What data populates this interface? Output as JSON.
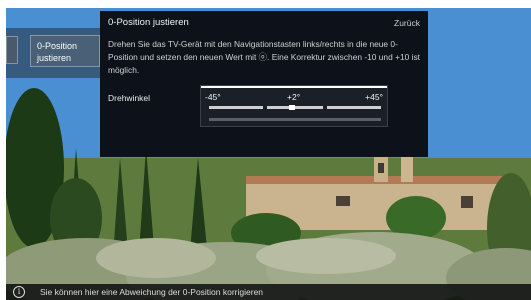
{
  "menu": {
    "item_label": "0-Position justieren"
  },
  "dialog": {
    "title": "0-Position justieren",
    "back_label": "Zurück",
    "description": "Drehen Sie das TV-Gerät mit den Navigationstasten links/rechts in die neue 0-Position und setzen den neuen Wert mit ⓞ. Eine Korrektur zwischen -10 und +10 ist möglich.",
    "setting_label": "Drehwinkel",
    "slider": {
      "min_label": "-45°",
      "value_label": "+2°",
      "max_label": "+45°",
      "value": 2,
      "min": -45,
      "max": 45
    }
  },
  "info_bar": {
    "icon": "info-icon",
    "text": "Sie können hier eine Abweichung der 0-Position korrigieren"
  },
  "colors": {
    "sky": "#4a8fd2",
    "panel": "#08090c",
    "accent": "#ffffff"
  }
}
